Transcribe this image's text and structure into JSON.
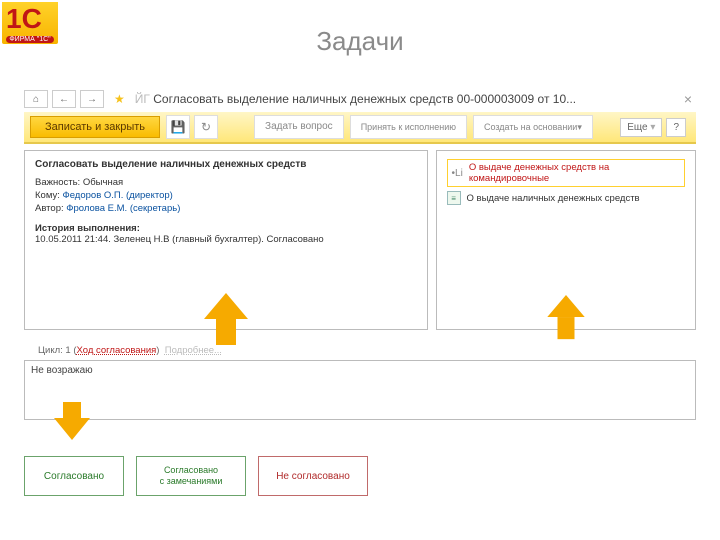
{
  "page": {
    "title": "Задачи"
  },
  "logo": {
    "text": "1С",
    "sub": "ФИРМА \"1С\""
  },
  "crumb": {
    "prefix": "ЙГ",
    "title": "Согласовать выделение наличных денежных средств 00-000003009 от 10..."
  },
  "ribbon": {
    "save_close": "Записать и закрыть",
    "ask": "Задать вопрос",
    "accept": "Принять к исполнению",
    "create": "Создать на основании",
    "more": "Еще",
    "help": "?"
  },
  "task": {
    "heading": "Согласовать выделение наличных денежных средств",
    "importance_label": "Важность:",
    "importance_value": "Обычная",
    "to_label": "Кому:",
    "to_value": "Федоров О.П. (директор)",
    "author_label": "Автор:",
    "author_value": "Фролова Е.М. (секретарь)",
    "history_label": "История выполнения:",
    "history_line": "10.05.2011 21:44. Зеленец Н.В (главный бухгалтер). Согласовано"
  },
  "attachments": {
    "items": [
      {
        "text": "О выдаче денежных средств на командировочные",
        "highlight": true
      },
      {
        "text": "О выдаче наличных денежных средств",
        "highlight": false
      }
    ]
  },
  "cycle": {
    "text_prefix": "Цикл: 1 (",
    "link": "Ход согласования",
    "tail": ")",
    "ghost": "Подробнее..."
  },
  "comment": {
    "value": "Не возражаю"
  },
  "decisions": {
    "ok": "Согласовано",
    "ok_remarks_l1": "Согласовано",
    "ok_remarks_l2": "с замечаниями",
    "no": "Не согласовано"
  }
}
